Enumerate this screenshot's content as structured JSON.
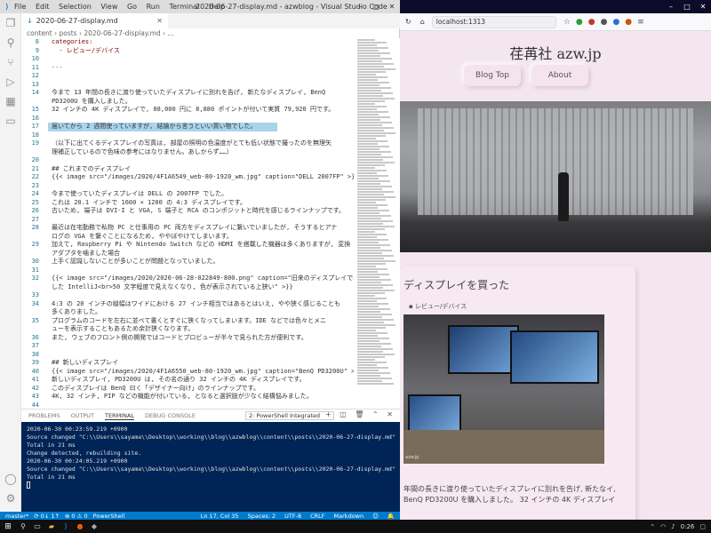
{
  "vscode": {
    "window_title": "2020-06-27-display.md - azwblog - Visual Studio Code",
    "menu": [
      "File",
      "Edit",
      "Selection",
      "View",
      "Go",
      "Run",
      "Terminal",
      "Help"
    ],
    "tab_label": "2020-06-27-display.md",
    "breadcrumb": "content › posts › 2020-06-27-display.md › ...",
    "lines": [
      {
        "n": "8",
        "t": "categories:",
        "cls": "key"
      },
      {
        "n": "9",
        "t": "  - レビュー/デバイス",
        "cls": "key"
      },
      {
        "n": "10",
        "t": "",
        "cls": ""
      },
      {
        "n": "11",
        "t": "---",
        "cls": "dim"
      },
      {
        "n": "12",
        "t": "",
        "cls": ""
      },
      {
        "n": "13",
        "t": "",
        "cls": ""
      },
      {
        "n": "14",
        "t": "今まで 13 年間の長きに渡り使っていたディスプレイに別れを告げ, 新たなディスプレイ, BenQ",
        "cls": ""
      },
      {
        "n": "",
        "t": "PD3200U を購入しました。",
        "cls": ""
      },
      {
        "n": "15",
        "t": "32 インチの 4K ディスプレイで, 88,000 円に 8,880 ポイントが付いて実質 79,920 円です。",
        "cls": ""
      },
      {
        "n": "16",
        "t": "",
        "cls": ""
      },
      {
        "n": "17",
        "t": "届いてから 2 週間使っていますが, 結論から言うといい買い物でした。",
        "cls": ""
      },
      {
        "n": "18",
        "t": "",
        "cls": ""
      },
      {
        "n": "19",
        "t": "（以下に出てくるディスプレイの写真は, 部屋の照明の色温度がとても低い状態で撮ったのを無理矢",
        "cls": ""
      },
      {
        "n": "",
        "t": "理補正しているので色味の参考にはなりません。あしからず……）",
        "cls": ""
      },
      {
        "n": "20",
        "t": "",
        "cls": ""
      },
      {
        "n": "21",
        "t": "## これまでのディスプレイ",
        "cls": ""
      },
      {
        "n": "22",
        "t": "{{< image src=\"/images/2020/4F1A6549_web-80-1920_wm.jpg\" caption=\"DELL 2007FP\" >}}",
        "cls": ""
      },
      {
        "n": "23",
        "t": "",
        "cls": ""
      },
      {
        "n": "24",
        "t": "今まで使っていたディスプレイは DELL の 2007FP でした。",
        "cls": ""
      },
      {
        "n": "25",
        "t": "これは 20.1 インチで 1600 × 1200 の 4:3 ディスプレイです。",
        "cls": ""
      },
      {
        "n": "26",
        "t": "古いため, 端子は DVI-I と VGA, S 端子と RCA のコンポジットと時代を感じるラインナップです。",
        "cls": ""
      },
      {
        "n": "27",
        "t": "",
        "cls": ""
      },
      {
        "n": "28",
        "t": "最近は在宅勤務で私物 PC と仕事用の PC 両方をディスプレイに繋いでいましたが, そうするとアナ",
        "cls": ""
      },
      {
        "n": "",
        "t": "ログの VGA を繋ぐことになるため, ややぼやけてしまいます。",
        "cls": ""
      },
      {
        "n": "29",
        "t": "加えて, Raspberry Pi や Nintendo Switch などの HDMI を搭載した機器は多くありますが, 変換",
        "cls": ""
      },
      {
        "n": "",
        "t": "アダプタを噛ました場合",
        "cls": ""
      },
      {
        "n": "30",
        "t": "上手く認識しないことが多いことが問題となっていました。",
        "cls": ""
      },
      {
        "n": "31",
        "t": "",
        "cls": ""
      },
      {
        "n": "32",
        "t": "{{< image src=\"/images/2020/2020-06-28-022849-800.png\" caption=\"旧来のディスプレイで表示",
        "cls": ""
      },
      {
        "n": "",
        "t": "した IntelliJ<br>50 文字程度で見えなくなり, 色が表示されている上狭い\" >}}",
        "cls": ""
      },
      {
        "n": "33",
        "t": "",
        "cls": ""
      },
      {
        "n": "34",
        "t": "4:3 の 20 インチの縦幅はワイドにおける 27 インチ相当ではあるとはいえ, やや狭く感じることも",
        "cls": ""
      },
      {
        "n": "",
        "t": "多くありました。",
        "cls": ""
      },
      {
        "n": "35",
        "t": "プログラムのコードを左右に並べて書くとすぐに狭くなってしまいます。IDE などでは色々とメニ",
        "cls": ""
      },
      {
        "n": "",
        "t": "ューを表示することもあるため余計狭くなります。",
        "cls": ""
      },
      {
        "n": "36",
        "t": "また, ウェブのフロント側の開発ではコードとプロビューが半々で見られた方が便利です。",
        "cls": ""
      },
      {
        "n": "37",
        "t": "",
        "cls": ""
      },
      {
        "n": "38",
        "t": "",
        "cls": ""
      },
      {
        "n": "39",
        "t": "## 新しいディスプレイ",
        "cls": ""
      },
      {
        "n": "40",
        "t": "{{< image src=\"/images/2020/4F1A6550_web-80-1920_wm.jpg\" caption=\"BenQ PD3200U\" >}}",
        "cls": ""
      },
      {
        "n": "41",
        "t": "新しいディスプレイ, PD3200U は, その名の通り 32 インチの 4K ディスプレイです。",
        "cls": ""
      },
      {
        "n": "42",
        "t": "このディスプレイは BenQ 曰く「デザイナー向け」のラインナップです。",
        "cls": ""
      },
      {
        "n": "43",
        "t": "4K, 32 インチ, PIP などの機能が付いている, となると選択肢が少なく結構悩みました。",
        "cls": ""
      },
      {
        "n": "44",
        "t": "",
        "cls": ""
      },
      {
        "n": "45",
        "t": "このサイズの EIZO は予算的に厳しく, LG は下限いい感じなのですが, PIP は現時点で唯一 10",
        "cls": ""
      }
    ],
    "panel": {
      "tabs": [
        "PROBLEMS",
        "OUTPUT",
        "TERMINAL",
        "DEBUG CONSOLE"
      ],
      "terminal_select": "2: PowerShell Integrated",
      "terminal_lines": [
        "2020-06-30 00:23:59.219 +0900",
        "Source changed \"C:\\\\Users\\\\sayama\\\\Desktop\\\\working\\\\blog\\\\azwblog\\\\content\\\\posts\\\\2020-06-27-display.md\": WRITE",
        "Total in 21 ms",
        "",
        "Change detected, rebuilding site.",
        "2020-06-30 00:24:05.219 +0900",
        "Source changed \"C:\\\\Users\\\\sayama\\\\Desktop\\\\working\\\\blog\\\\azwblog\\\\content\\\\posts\\\\2020-06-27-display.md\": WRITE",
        "Total in 21 ms"
      ]
    },
    "status": {
      "branch": "master*",
      "sync": "⟳ 0↓ 1↑",
      "errors": "⊗ 0 ⚠ 0",
      "shell": "PowerShell",
      "position": "Ln 17, Col 35",
      "spaces": "Spaces: 2",
      "encoding": "UTF-8",
      "eol": "CRLF",
      "language": "Markdown"
    }
  },
  "browser": {
    "url": "localhost:1313",
    "site_title": "荏苒社 azw.jp",
    "nav": [
      "Blog Top",
      "About"
    ],
    "post_title": "ディスプレイを買った",
    "category": "レビュー/デバイス",
    "image_caption": "azw.jp",
    "excerpt": "年間の長きに渡り使っていたディスプレイに別れを告げ, 新たなイ, BenQ PD3200U を購入しました。 32 インチの 4K ディスプレイ"
  },
  "taskbar": {
    "clock": "0:26"
  }
}
